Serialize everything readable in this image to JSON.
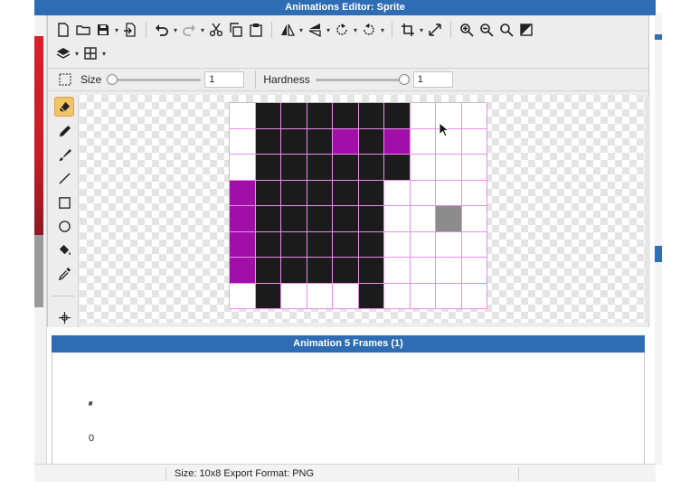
{
  "window": {
    "title": "Animations Editor: Sprite"
  },
  "toolbar": {
    "row1": [
      "new-file-icon",
      "open-folder-icon",
      "save-icon",
      "save-caret",
      "export-icon",
      "sep",
      "undo-icon",
      "undo-caret",
      "redo-icon",
      "redo-caret",
      "cut-icon",
      "copy-icon",
      "paste-icon",
      "sep",
      "flip-horizontal-icon",
      "flip-h-caret",
      "flip-vertical-icon",
      "flip-v-caret",
      "rotate-left-icon",
      "rotate-left-caret",
      "rotate-right-icon",
      "rotate-right-caret",
      "sep",
      "crop-icon",
      "crop-caret",
      "resize-icon",
      "sep",
      "zoom-in-icon",
      "zoom-out-icon",
      "zoom-fit-icon",
      "invert-icon"
    ],
    "row2": [
      "layers-icon",
      "layers-caret",
      "grid-icon",
      "grid-caret"
    ]
  },
  "options": {
    "size_label": "Size",
    "size_value": "1",
    "size_slider_fraction": 0.0,
    "hardness_label": "Hardness",
    "hardness_value": "1",
    "hardness_slider_fraction": 1.0
  },
  "tools": [
    "eraser-icon",
    "pencil-icon",
    "brush-icon",
    "line-icon",
    "rectangle-icon",
    "ellipse-icon",
    "fill-bucket-icon",
    "eyedropper-icon",
    "move-icon"
  ],
  "active_tool": "eraser-icon",
  "canvas": {
    "rows": 8,
    "cols": 10,
    "colors": {
      "K": "#1b1b1b",
      "M": "#a10fa8",
      "G": "#8c8c8c",
      ".": "#ffffff"
    },
    "pixels": [
      ".KKKKKK...",
      ".KKKMKM...",
      ".KKKKKK...",
      "MKKKKK....",
      "MKKKKK..G.",
      "MKKKKK....",
      "MKKKKK....",
      ".K...K...."
    ]
  },
  "animation": {
    "header": "Animation 5 Frames (1)",
    "frame_index_label": "0"
  },
  "status": {
    "text": "Size: 10x8   Export Format: PNG"
  }
}
